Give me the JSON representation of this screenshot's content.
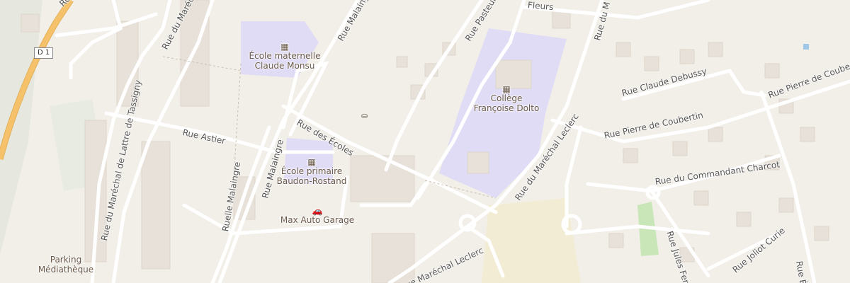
{
  "map": {
    "colors": {
      "background": "#f2efe9",
      "school_area": "#e0dcf5",
      "building": "#e7e1d9",
      "road": "#ffffff",
      "main_road": "#f5c26b",
      "green": "#c8e6b8"
    },
    "road_shield": "D 1",
    "streets": [
      "Rue de",
      "Rue du Maréchal",
      "Rue Malaingre",
      "Rue Pasteur",
      "Fleurs",
      "Rue du M",
      "Rue Claude Debussy",
      "Rue Pierre de Coubertin",
      "Rue Pierre de Coubertin",
      "Rue Astier",
      "Rue du Maréchal de Lattre de Tassigny",
      "Rue des Écoles",
      "Ruelle Malaingre",
      "Rue Malaingre",
      "Rue du Maréchal Leclerc",
      "Rue du Commandant Charcot",
      "Rue Jules Ferry",
      "Rue Joliot Curie",
      "Rue Maréchal Leclerc",
      "Rue Ém"
    ],
    "pois": [
      {
        "name": "École maternelle Claude Monsu",
        "line1": "École maternelle",
        "line2": "Claude Monsu",
        "icon": "school-icon"
      },
      {
        "name": "Collège Françoise Dolto",
        "line1": "Collège",
        "line2": "Françoise Dolto",
        "icon": "school-icon"
      },
      {
        "name": "École primaire Baudon-Rostand",
        "line1": "École primaire",
        "line2": "Baudon-Rostand",
        "icon": "school-icon"
      },
      {
        "name": "Max Auto Garage",
        "line1": "Max Auto Garage",
        "icon": "car-repair-icon"
      },
      {
        "name": "Parking Médiathèque",
        "line1": "Parking",
        "line2": "Médiathèque",
        "icon": "parking-icon"
      }
    ],
    "extra_icons": [
      "playground-icon"
    ]
  }
}
